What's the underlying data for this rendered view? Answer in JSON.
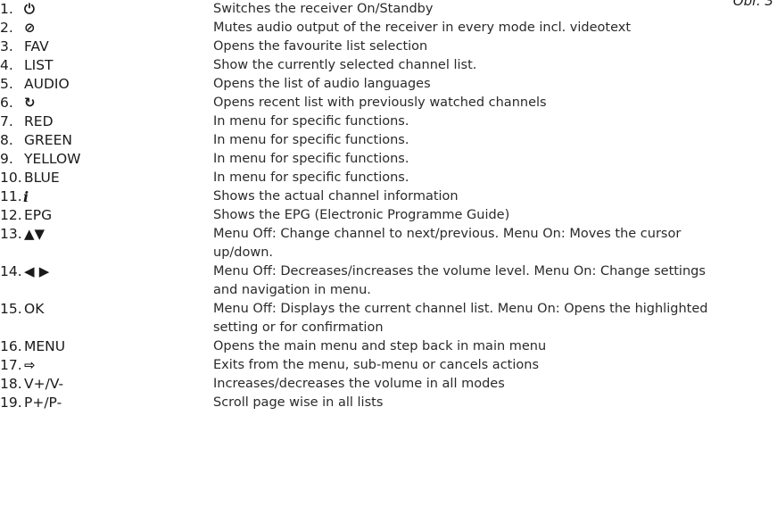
{
  "page_ref": "Obr. 3",
  "items": [
    {
      "num": "1.",
      "key": "⏻",
      "key_type": "sym",
      "icon": "power-icon",
      "desc": "Switches the receiver On/Standby"
    },
    {
      "num": "2.",
      "key": "⊘",
      "key_type": "sym",
      "icon": "mute-icon",
      "desc": "Mutes audio output of the receiver in every mode incl. videotext"
    },
    {
      "num": "3.",
      "key": "FAV",
      "key_type": "text",
      "desc": "Opens the favourite list selection"
    },
    {
      "num": "4.",
      "key": "LIST",
      "key_type": "text",
      "desc": "Show the currently selected channel list."
    },
    {
      "num": "5.",
      "key": "AUDIO",
      "key_type": "text",
      "desc": "Opens the list of audio languages"
    },
    {
      "num": "6.",
      "key": "↻",
      "key_type": "sym",
      "icon": "recall-icon",
      "desc": "Opens recent list with previously watched channels"
    },
    {
      "num": "7.",
      "key": "RED",
      "key_type": "text",
      "desc": "In menu for specific functions."
    },
    {
      "num": "8.",
      "key": "GREEN",
      "key_type": "text",
      "desc": "In menu for specific functions."
    },
    {
      "num": "9.",
      "key": "YELLOW",
      "key_type": "text",
      "desc": "In menu for specific functions."
    },
    {
      "num": "10.",
      "key": "BLUE",
      "key_type": "text",
      "desc": "In menu for specific functions."
    },
    {
      "num": "11.",
      "key": "i",
      "key_type": "info",
      "icon": "info-icon",
      "desc": "Shows the actual channel information"
    },
    {
      "num": "12.",
      "key": "EPG",
      "key_type": "text",
      "desc": "Shows the EPG (Electronic Programme Guide)"
    },
    {
      "num": "13.",
      "key": "▲▼",
      "key_type": "sym",
      "icon": "up-down-arrows-icon",
      "desc": "Menu Off: Change channel to next/previous. Menu On: Moves the cursor up/down."
    },
    {
      "num": "14.",
      "key": "◀ ▶",
      "key_type": "sym",
      "icon": "left-right-arrows-icon",
      "desc": "Menu Off: Decreases/increases the volume level. Menu On: Change settings and navigation in menu."
    },
    {
      "num": "15.",
      "key": "OK",
      "key_type": "text",
      "desc": "Menu Off: Displays the current channel list. Menu On: Opens the highlighted setting or for confirmation"
    },
    {
      "num": "16.",
      "key": "MENU",
      "key_type": "text",
      "desc": "Opens the main menu and step back in main menu"
    },
    {
      "num": "17.",
      "key": "⇨",
      "key_type": "sym",
      "icon": "exit-icon",
      "desc": "Exits from the menu, sub-menu or cancels actions"
    },
    {
      "num": "18.",
      "key": "V+/V-",
      "key_type": "text",
      "desc": "Increases/decreases the volume in all modes"
    },
    {
      "num": "19.",
      "key": "P+/P-",
      "key_type": "text",
      "desc": "Scroll page wise in all lists"
    }
  ]
}
